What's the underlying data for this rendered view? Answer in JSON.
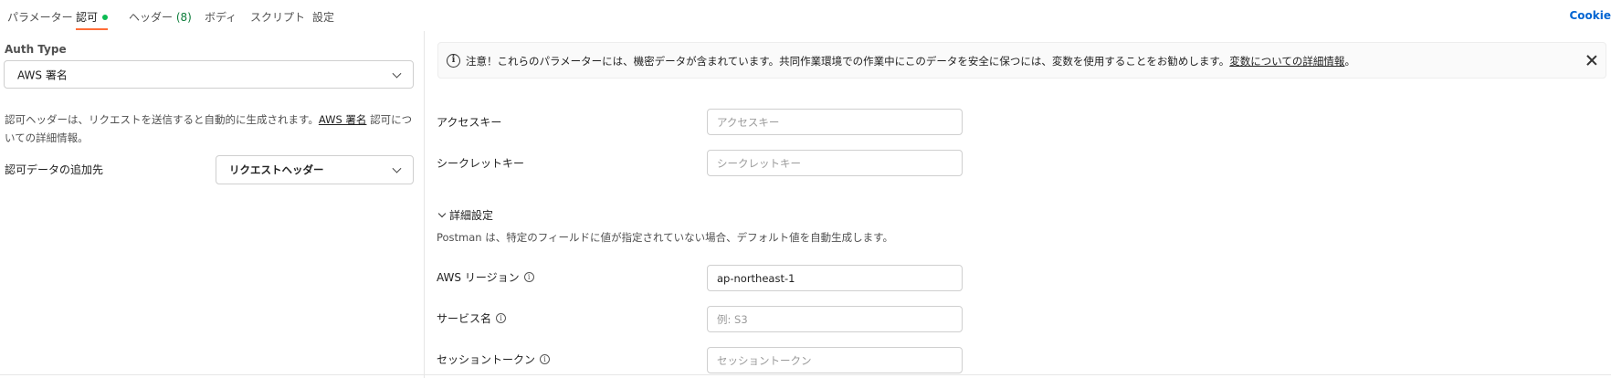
{
  "tabs": [
    {
      "label": "パラメーター"
    },
    {
      "label": "認可",
      "active": true,
      "status_dot_color": "#0cbb52"
    },
    {
      "label": "ヘッダー",
      "count": "(8)"
    },
    {
      "label": "ボディ"
    },
    {
      "label": "スクリプト"
    },
    {
      "label": "設定"
    }
  ],
  "cookies_link": "Cookie",
  "auth": {
    "type_label": "Auth Type",
    "type_value": "AWS 署名",
    "description_pre": "認可ヘッダーは、リクエストを送信すると自動的に生成されます。",
    "description_link": "AWS 署名",
    "description_post": " 認可についての詳細情報。",
    "add_to_label": "認可データの追加先",
    "add_to_value": "リクエストヘッダー"
  },
  "alert": {
    "text": "注意！これらのパラメーターには、機密データが含まれています。共同作業環境での作業中にこのデータを安全に保つには、変数を使用することをお勧めします。",
    "link": "変数についての詳細情報",
    "suffix": "。"
  },
  "fields": {
    "access_key": {
      "label": "アクセスキー",
      "placeholder": "アクセスキー",
      "value": ""
    },
    "secret_key": {
      "label": "シークレットキー",
      "placeholder": "シークレットキー",
      "value": ""
    }
  },
  "advanced": {
    "toggle_label": "詳細設定",
    "description": "Postman は、特定のフィールドに値が指定されていない場合、デフォルト値を自動生成します。",
    "region": {
      "label": "AWS リージョン",
      "value": "ap-northeast-1",
      "placeholder": ""
    },
    "service": {
      "label": "サービス名",
      "placeholder": "例: S3",
      "value": ""
    },
    "session_token": {
      "label": "セッショントークン",
      "placeholder": "セッショントークン",
      "value": ""
    }
  },
  "colors": {
    "accent": "#ff6c37",
    "link": "#0265d2",
    "status_green": "#0cbb52"
  },
  "icons": [
    "info-icon",
    "close-icon",
    "chevron-down-icon"
  ]
}
